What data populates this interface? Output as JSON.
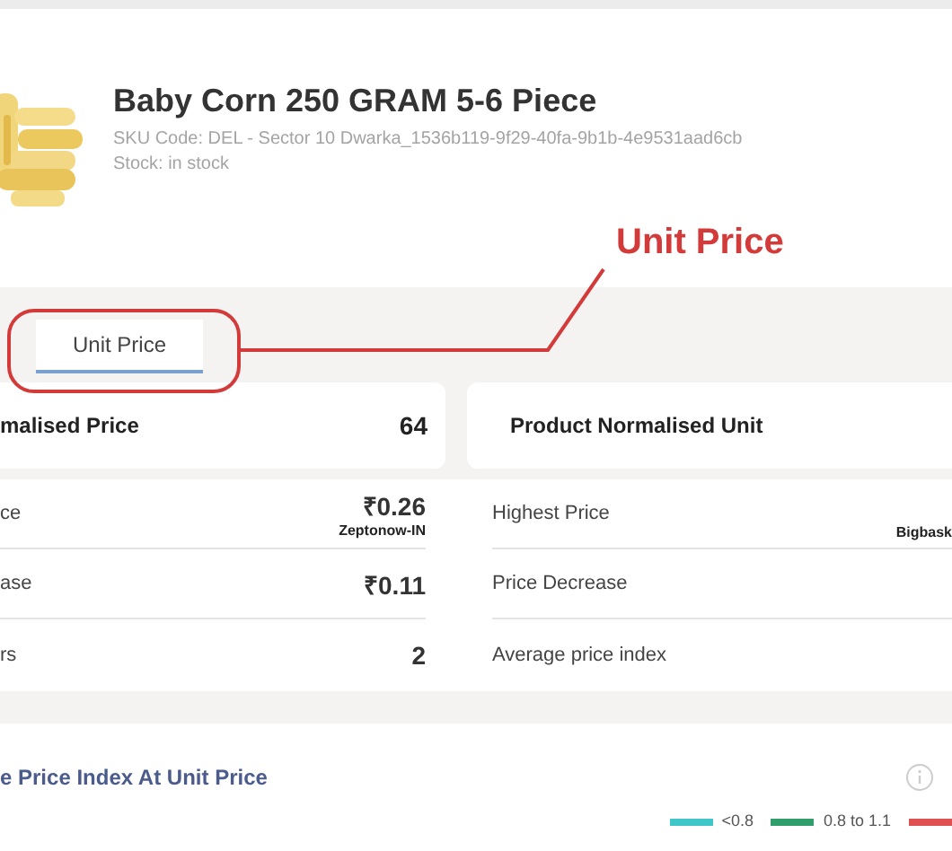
{
  "product": {
    "title": "Baby Corn 250 GRAM 5-6 Piece",
    "sku": "SKU Code: DEL - Sector 10 Dwarka_1536b119-9f29-40fa-9b1b-4e9531aad6cb",
    "stock": "Stock: in stock"
  },
  "annotation": {
    "label": "Unit Price"
  },
  "tabs": [
    {
      "label": "Unit Price",
      "selected": true
    }
  ],
  "summary_cards": [
    {
      "label": "malised Price",
      "value": "64"
    },
    {
      "label": "Product Normalised Unit"
    }
  ],
  "stats": {
    "left": [
      {
        "label": "ce",
        "value": "₹0.26",
        "source": "Zeptonow-IN"
      },
      {
        "label": "ase",
        "value": "₹0.11"
      },
      {
        "label": "rs",
        "value": "2"
      }
    ],
    "right": [
      {
        "label": "Highest Price",
        "source": "Bigbask"
      },
      {
        "label": "Price Decrease"
      },
      {
        "label": "Average price index"
      }
    ]
  },
  "price_index": {
    "title": "e Price Index At Unit Price",
    "legend": [
      {
        "label": "<0.8",
        "color": "#3fc6c8"
      },
      {
        "label": "0.8 to 1.1",
        "color": "#2f9e6a"
      },
      {
        "color": "#e05050"
      }
    ]
  }
}
